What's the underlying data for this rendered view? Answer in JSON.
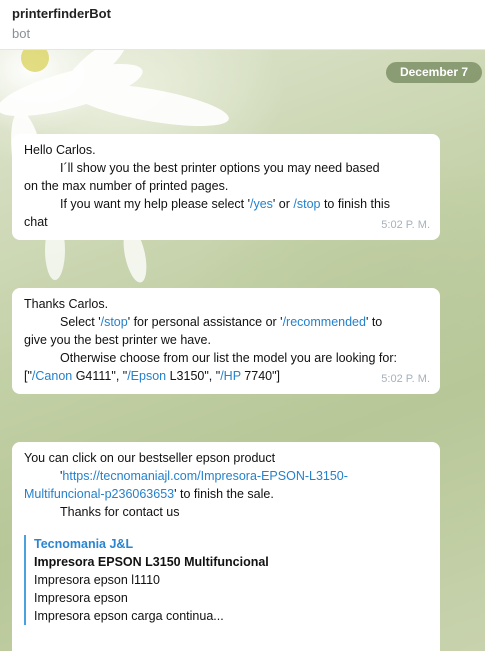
{
  "header": {
    "title": "printerfinderBot",
    "status": "bot"
  },
  "date_label": "December 7",
  "msg1": {
    "greeting": "Hello Carlos.",
    "line1": "I´ll show you the best printer options you may need based",
    "line2": "on the max number of printed pages.",
    "line3_a": "If you want my help please select '",
    "cmd_yes": "/yes",
    "line3_b": "' or ",
    "cmd_stop": "/stop",
    "line3_c": " to finish this",
    "line4": "chat",
    "time": "5:02 P. M."
  },
  "msg2": {
    "line1": "Thanks Carlos.",
    "l2_a": "Select '",
    "cmd_stop": "/stop",
    "l2_b": "' for personal assistance or '",
    "cmd_recommended": "/recommended",
    "l2_c": "' to",
    "line3": "give you the best printer we have.",
    "line4": "Otherwise choose from our list the model you are looking for:",
    "l5_a": "[\"",
    "cmd_canon": "/Canon",
    "l5_b": " G4111\", \"",
    "cmd_epson": "/Epson",
    "l5_c": " L3150\", \"",
    "cmd_hp": "/HP",
    "l5_d": " 7740\"]",
    "time": "5:02 P. M."
  },
  "msg3": {
    "line1": "You can click on our bestseller epson product",
    "l2_a": "'",
    "url_part1": "https://tecnomaniajl.com/Impresora-EPSON-L3150-",
    "url_part2": "Multifuncional-p236063653",
    "l3_b": "' to finish the sale.",
    "line4": "Thanks for contact us",
    "preview": {
      "site": "Tecnomania J&L",
      "title": "Impresora EPSON L3150 Multifuncional",
      "desc1": "Impresora epson l1110",
      "desc2": "Impresora epson",
      "desc3": "Impresora epson carga continua..."
    }
  },
  "colors": {
    "accent": "#2481cc",
    "date_pill": "#7e9166",
    "bubble": "#ffffff"
  }
}
